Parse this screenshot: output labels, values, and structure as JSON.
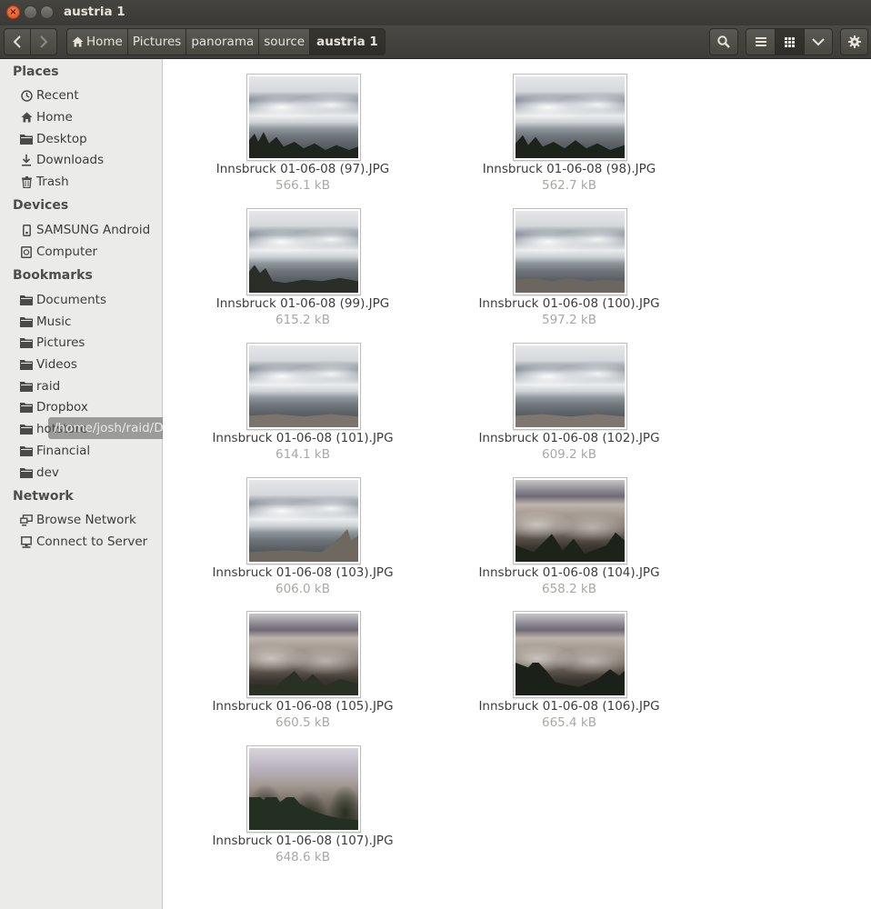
{
  "window": {
    "title": "austria 1"
  },
  "toolbar": {
    "breadcrumbs": [
      "Home",
      "Pictures",
      "panorama",
      "source",
      "austria 1"
    ]
  },
  "sidebar": {
    "places": {
      "heading": "Places",
      "items": [
        {
          "label": "Recent",
          "icon": "clock-icon"
        },
        {
          "label": "Home",
          "icon": "home-icon"
        },
        {
          "label": "Desktop",
          "icon": "folder-icon"
        },
        {
          "label": "Downloads",
          "icon": "download-icon"
        },
        {
          "label": "Trash",
          "icon": "trash-icon"
        }
      ]
    },
    "devices": {
      "heading": "Devices",
      "items": [
        {
          "label": "SAMSUNG Android",
          "icon": "phone-icon"
        },
        {
          "label": "Computer",
          "icon": "drive-icon"
        }
      ]
    },
    "bookmarks": {
      "heading": "Bookmarks",
      "items": [
        {
          "label": "Documents",
          "icon": "folder-icon"
        },
        {
          "label": "Music",
          "icon": "folder-icon"
        },
        {
          "label": "Pictures",
          "icon": "folder-icon"
        },
        {
          "label": "Videos",
          "icon": "folder-icon"
        },
        {
          "label": "raid",
          "icon": "folder-icon"
        },
        {
          "label": "Dropbox",
          "icon": "folder-icon"
        },
        {
          "label": "hotstore",
          "icon": "folder-icon"
        },
        {
          "label": "Financial",
          "icon": "folder-icon"
        },
        {
          "label": "dev",
          "icon": "folder-icon"
        }
      ]
    },
    "network": {
      "heading": "Network",
      "items": [
        {
          "label": "Browse Network",
          "icon": "network-icon"
        },
        {
          "label": "Connect to Server",
          "icon": "server-icon"
        }
      ]
    },
    "tooltip": "/home/josh/raid/Dropbox"
  },
  "files": [
    {
      "name": "Innsbruck 01-06-08 (97).JPG",
      "size": "566.1 kB",
      "thumb": "cloud"
    },
    {
      "name": "Innsbruck 01-06-08 (98).JPG",
      "size": "562.7 kB",
      "thumb": "cloud"
    },
    {
      "name": "Innsbruck 01-06-08 (99).JPG",
      "size": "615.2 kB",
      "thumb": "cloud"
    },
    {
      "name": "Innsbruck 01-06-08 (100).JPG",
      "size": "597.2 kB",
      "thumb": "cloud"
    },
    {
      "name": "Innsbruck 01-06-08 (101).JPG",
      "size": "614.1 kB",
      "thumb": "cloud"
    },
    {
      "name": "Innsbruck 01-06-08 (102).JPG",
      "size": "609.2 kB",
      "thumb": "cloud"
    },
    {
      "name": "Innsbruck 01-06-08 (103).JPG",
      "size": "606.0 kB",
      "thumb": "cloud"
    },
    {
      "name": "Innsbruck 01-06-08 (104).JPG",
      "size": "658.2 kB",
      "thumb": "city"
    },
    {
      "name": "Innsbruck 01-06-08 (105).JPG",
      "size": "660.5 kB",
      "thumb": "city"
    },
    {
      "name": "Innsbruck 01-06-08 (106).JPG",
      "size": "665.4 kB",
      "thumb": "city"
    },
    {
      "name": "Innsbruck 01-06-08 (107).JPG",
      "size": "648.6 kB",
      "thumb": "trees"
    }
  ]
}
